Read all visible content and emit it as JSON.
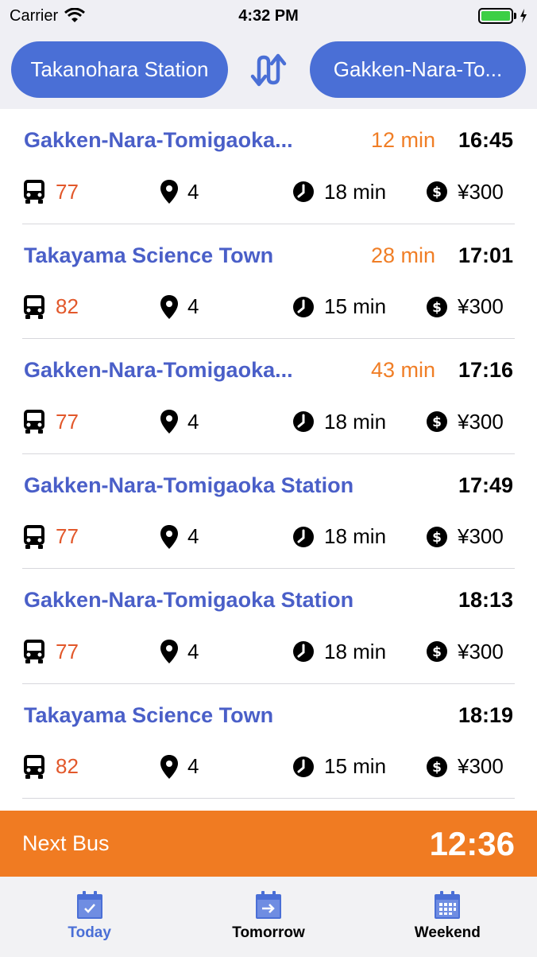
{
  "status_bar": {
    "carrier": "Carrier",
    "time": "4:32 PM"
  },
  "header": {
    "from_station": "Takanohara Station",
    "to_station": "Gakken-Nara-To..."
  },
  "departures": [
    {
      "destination": "Gakken-Nara-Tomigaoka...",
      "wait": "12 min",
      "time": "16:45",
      "route": "77",
      "stops": "4",
      "duration": "18 min",
      "fare": "¥300"
    },
    {
      "destination": "Takayama Science Town",
      "wait": "28 min",
      "time": "17:01",
      "route": "82",
      "stops": "4",
      "duration": "15 min",
      "fare": "¥300"
    },
    {
      "destination": "Gakken-Nara-Tomigaoka...",
      "wait": "43 min",
      "time": "17:16",
      "route": "77",
      "stops": "4",
      "duration": "18 min",
      "fare": "¥300"
    },
    {
      "destination": "Gakken-Nara-Tomigaoka Station",
      "wait": "",
      "time": "17:49",
      "route": "77",
      "stops": "4",
      "duration": "18 min",
      "fare": "¥300"
    },
    {
      "destination": "Gakken-Nara-Tomigaoka Station",
      "wait": "",
      "time": "18:13",
      "route": "77",
      "stops": "4",
      "duration": "18 min",
      "fare": "¥300"
    },
    {
      "destination": "Takayama Science Town",
      "wait": "",
      "time": "18:19",
      "route": "82",
      "stops": "4",
      "duration": "15 min",
      "fare": "¥300"
    }
  ],
  "next_bus": {
    "label": "Next Bus",
    "countdown": "12:36"
  },
  "tabs": [
    {
      "label": "Today",
      "icon": "calendar-check-icon"
    },
    {
      "label": "Tomorrow",
      "icon": "calendar-arrow-icon"
    },
    {
      "label": "Weekend",
      "icon": "calendar-grid-icon"
    }
  ],
  "colors": {
    "accent": "#4a6fd6",
    "title": "#4a5fc8",
    "wait": "#f07e26",
    "route": "#e2582b",
    "next_bus_bg": "#f07b22"
  }
}
